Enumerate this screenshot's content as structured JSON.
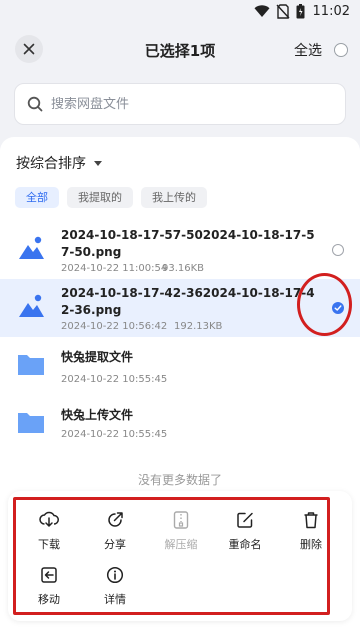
{
  "status_bar": {
    "time": "11:02",
    "icons": [
      "wifi-icon",
      "no-sim-icon",
      "battery-icon"
    ]
  },
  "header": {
    "title": "已选择1项",
    "select_all_label": "全选"
  },
  "search": {
    "placeholder": "搜索网盘文件"
  },
  "sort": {
    "label": "按综合排序"
  },
  "filters": [
    {
      "label": "全部",
      "active": true
    },
    {
      "label": "我提取的",
      "active": false
    },
    {
      "label": "我上传的",
      "active": false
    }
  ],
  "files": [
    {
      "name": "2024-10-18-17-57-502024-10-18-17-57-50.png",
      "date": "2024-10-22 11:00:54",
      "size": "93.16KB",
      "type": "image",
      "selected": false
    },
    {
      "name": "2024-10-18-17-42-362024-10-18-17-42-36.png",
      "date": "2024-10-22 10:56:42",
      "size": "192.13KB",
      "type": "image",
      "selected": true
    },
    {
      "name": "快兔提取文件",
      "date": "2024-10-22 10:55:45",
      "size": "",
      "type": "folder",
      "selected": false
    },
    {
      "name": "快兔上传文件",
      "date": "2024-10-22 10:55:45",
      "size": "",
      "type": "folder",
      "selected": false
    }
  ],
  "no_more_text": "没有更多数据了",
  "actions": [
    {
      "label": "下载",
      "icon": "download-icon",
      "enabled": true
    },
    {
      "label": "分享",
      "icon": "share-icon",
      "enabled": true
    },
    {
      "label": "解压缩",
      "icon": "unzip-icon",
      "enabled": false
    },
    {
      "label": "重命名",
      "icon": "rename-icon",
      "enabled": true
    },
    {
      "label": "删除",
      "icon": "delete-icon",
      "enabled": true
    },
    {
      "label": "移动",
      "icon": "move-icon",
      "enabled": true
    },
    {
      "label": "详情",
      "icon": "info-icon",
      "enabled": true
    }
  ],
  "colors": {
    "accent": "#3a74ef",
    "annotation": "#d21f1f",
    "folder": "#6aa2f7"
  }
}
